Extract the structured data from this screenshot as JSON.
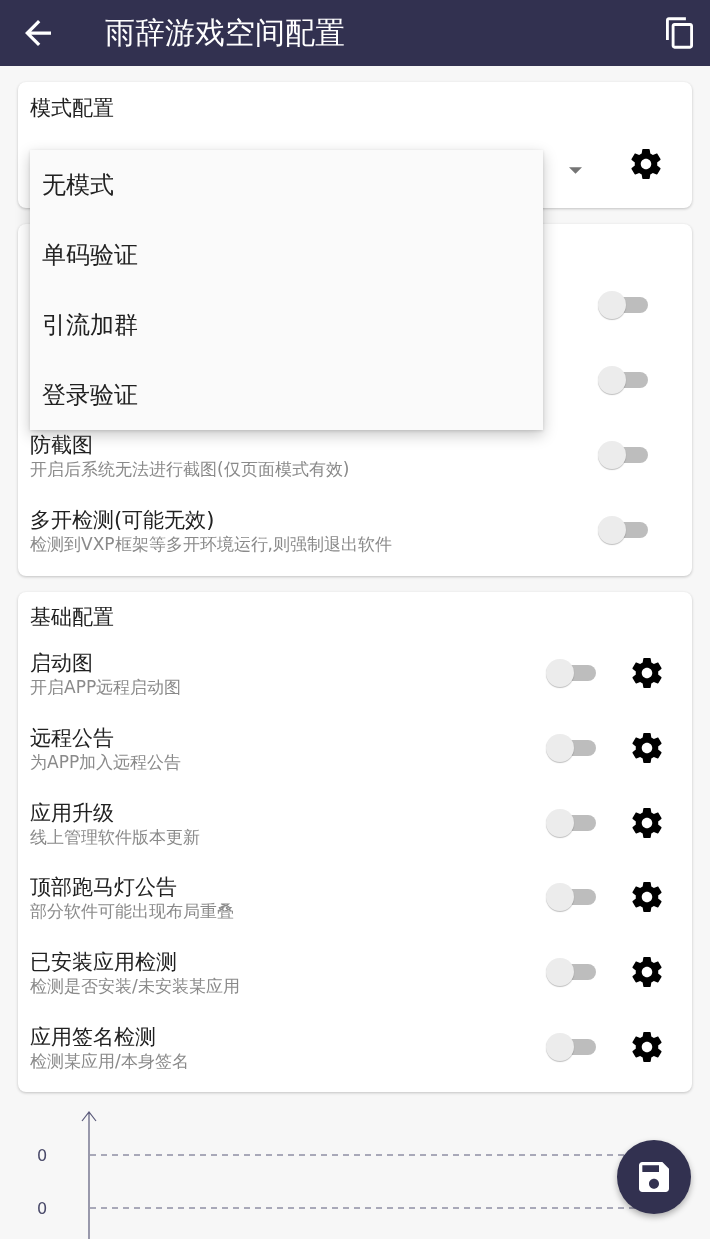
{
  "app_bar": {
    "title": "雨辞游戏空间配置"
  },
  "mode_card": {
    "title": "模式配置",
    "dropdown": {
      "expanded": true,
      "options": [
        {
          "label": "无模式",
          "selected": false
        },
        {
          "label": "单码验证",
          "selected": false
        },
        {
          "label": "引流加群",
          "selected": false
        },
        {
          "label": "登录验证",
          "selected": false
        }
      ]
    }
  },
  "security_card": {
    "items": [
      {
        "on": false
      },
      {
        "on": false
      },
      {
        "title": "防截图",
        "subtitle": "开启后系统无法进行截图(仅页面模式有效)",
        "on": false
      },
      {
        "title": "多开检测(可能无效)",
        "subtitle": "检测到VXP框架等多开环境运行,则强制退出软件",
        "on": false
      }
    ]
  },
  "basic_card": {
    "title": "基础配置",
    "items": [
      {
        "title": "启动图",
        "subtitle": "开启APP远程启动图",
        "on": false
      },
      {
        "title": "远程公告",
        "subtitle": "为APP加入远程公告",
        "on": false
      },
      {
        "title": "应用升级",
        "subtitle": "线上管理软件版本更新",
        "on": false
      },
      {
        "title": "顶部跑马灯公告",
        "subtitle": "部分软件可能出现布局重叠",
        "on": false
      },
      {
        "title": "已安装应用检测",
        "subtitle": "检测是否安装/未安装某应用",
        "on": false
      },
      {
        "title": "应用签名检测",
        "subtitle": "检测某应用/本身签名",
        "on": false
      }
    ]
  },
  "chart": {
    "tick_labels": [
      "0",
      "0"
    ]
  }
}
